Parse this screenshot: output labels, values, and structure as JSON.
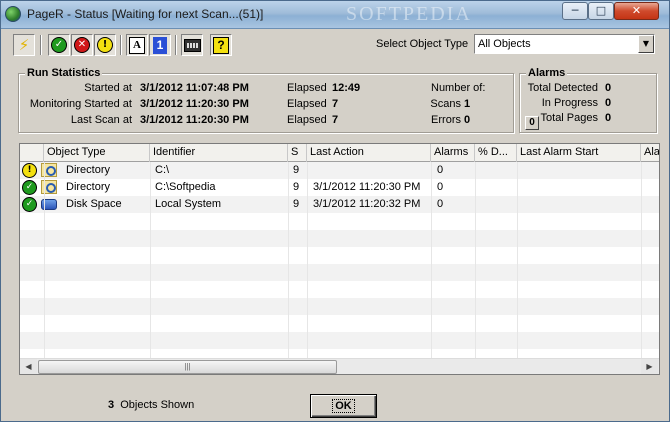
{
  "window": {
    "title": "PageR - Status [Waiting for next Scan...(51)]",
    "watermark": "SOFTPEDIA",
    "minimize": "─",
    "maximize": "□",
    "close": "✕"
  },
  "toolbar": {
    "bolt": "⚡",
    "check": "✓",
    "x": "✕",
    "alert": "!",
    "font_a": "A",
    "one": "1",
    "help": "?"
  },
  "filter": {
    "label": "Select Object Type",
    "value": "All Objects",
    "arrow": "▼"
  },
  "run_statistics": {
    "title": "Run Statistics",
    "started_label": "Started at",
    "started_value": "3/1/2012 11:07:48 PM",
    "monitoring_label": "Monitoring Started at",
    "monitoring_value": "3/1/2012 11:20:30 PM",
    "last_scan_label": "Last Scan at",
    "last_scan_value": "3/1/2012 11:20:30 PM",
    "elapsed_label": "Elapsed",
    "elapsed_1": "12:49",
    "elapsed_2": "7",
    "elapsed_3": "7",
    "number_of_label": "Number of:",
    "scans_label": "Scans",
    "scans_value": "1",
    "errors_label": "Errors",
    "errors_value": "0"
  },
  "alarms": {
    "title": "Alarms",
    "total_detected_label": "Total Detected",
    "total_detected_value": "0",
    "in_progress_label": "In Progress",
    "in_progress_value": "0",
    "total_pages_label": "Total Pages",
    "total_pages_value": "0",
    "reset_button": "0"
  },
  "table": {
    "columns": [
      "Object Type",
      "Identifier",
      "S",
      "Last Action",
      "Alarms",
      "% D...",
      "Last Alarm Start",
      "Ala"
    ],
    "rows": [
      {
        "status": "yellow",
        "status_glyph": "!",
        "type_icon": "directory-icon",
        "object_type": "Directory",
        "identifier": "C:\\",
        "s": "9",
        "last_action": "",
        "alarms": "0"
      },
      {
        "status": "green",
        "status_glyph": "✓",
        "type_icon": "directory-icon",
        "object_type": "Directory",
        "identifier": "C:\\Softpedia",
        "s": "9",
        "last_action": "3/1/2012 11:20:30 PM",
        "alarms": "0"
      },
      {
        "status": "green",
        "status_glyph": "✓",
        "type_icon": "disk-icon",
        "object_type": "Disk Space",
        "identifier": "Local System",
        "s": "9",
        "last_action": "3/1/2012 11:20:32 PM",
        "alarms": "0"
      }
    ],
    "scroll_left": "◀",
    "scroll_right": "▶",
    "thumb_grip": "|||"
  },
  "footer": {
    "count": "3",
    "count_label": "Objects Shown",
    "ok_label": "OK"
  }
}
